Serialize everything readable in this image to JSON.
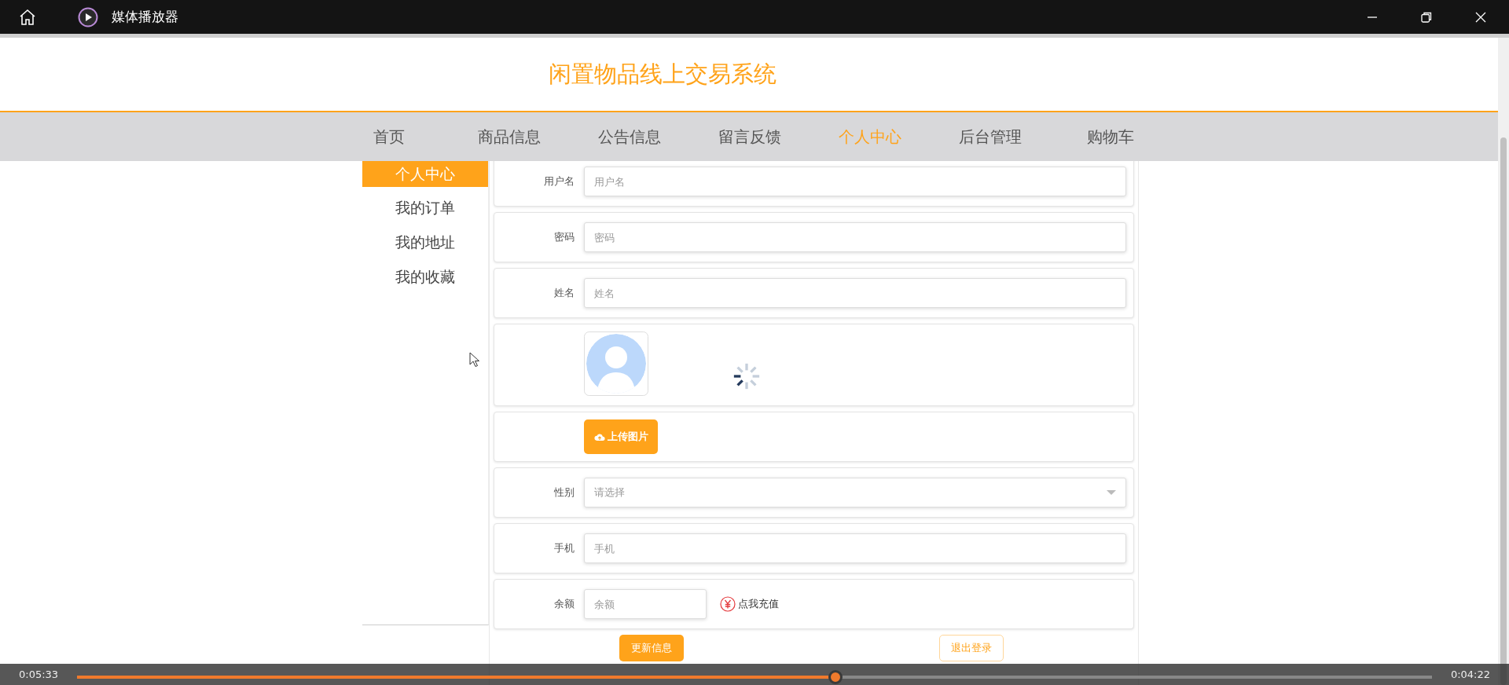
{
  "player": {
    "title": "媒体播放器",
    "elapsed": "0:05:33",
    "remaining": "0:04:22",
    "level": 0.56
  },
  "site": {
    "title": "闲置物品线上交易系统"
  },
  "nav": [
    {
      "label": "首页",
      "selected": false
    },
    {
      "label": "商品信息",
      "selected": false
    },
    {
      "label": "公告信息",
      "selected": false
    },
    {
      "label": "留言反馈",
      "selected": false
    },
    {
      "label": "个人中心",
      "selected": true
    },
    {
      "label": "后台管理",
      "selected": false
    },
    {
      "label": "购物车",
      "selected": false
    }
  ],
  "sidebar": [
    {
      "label": "个人中心",
      "selected": true
    },
    {
      "label": "我的订单",
      "selected": false
    },
    {
      "label": "我的地址",
      "selected": false
    },
    {
      "label": "我的收藏",
      "selected": false
    }
  ],
  "form": {
    "fields": [
      {
        "kind": "input",
        "label": "用户名",
        "placeholder": "用户名"
      },
      {
        "kind": "input",
        "label": "密码",
        "placeholder": "密码"
      },
      {
        "kind": "input",
        "label": "姓名",
        "placeholder": "姓名"
      },
      {
        "kind": "avatar"
      },
      {
        "kind": "upload",
        "button": "上传图片"
      },
      {
        "kind": "select",
        "label": "性别",
        "placeholder": "请选择"
      },
      {
        "kind": "input",
        "label": "手机",
        "placeholder": "手机"
      },
      {
        "kind": "balance",
        "label": "余额",
        "placeholder": "余额",
        "link": "点我充值"
      }
    ],
    "buttons": [
      {
        "label": "更新信息",
        "kind": "primary"
      },
      {
        "label": "退出登录",
        "kind": "outline"
      }
    ]
  }
}
